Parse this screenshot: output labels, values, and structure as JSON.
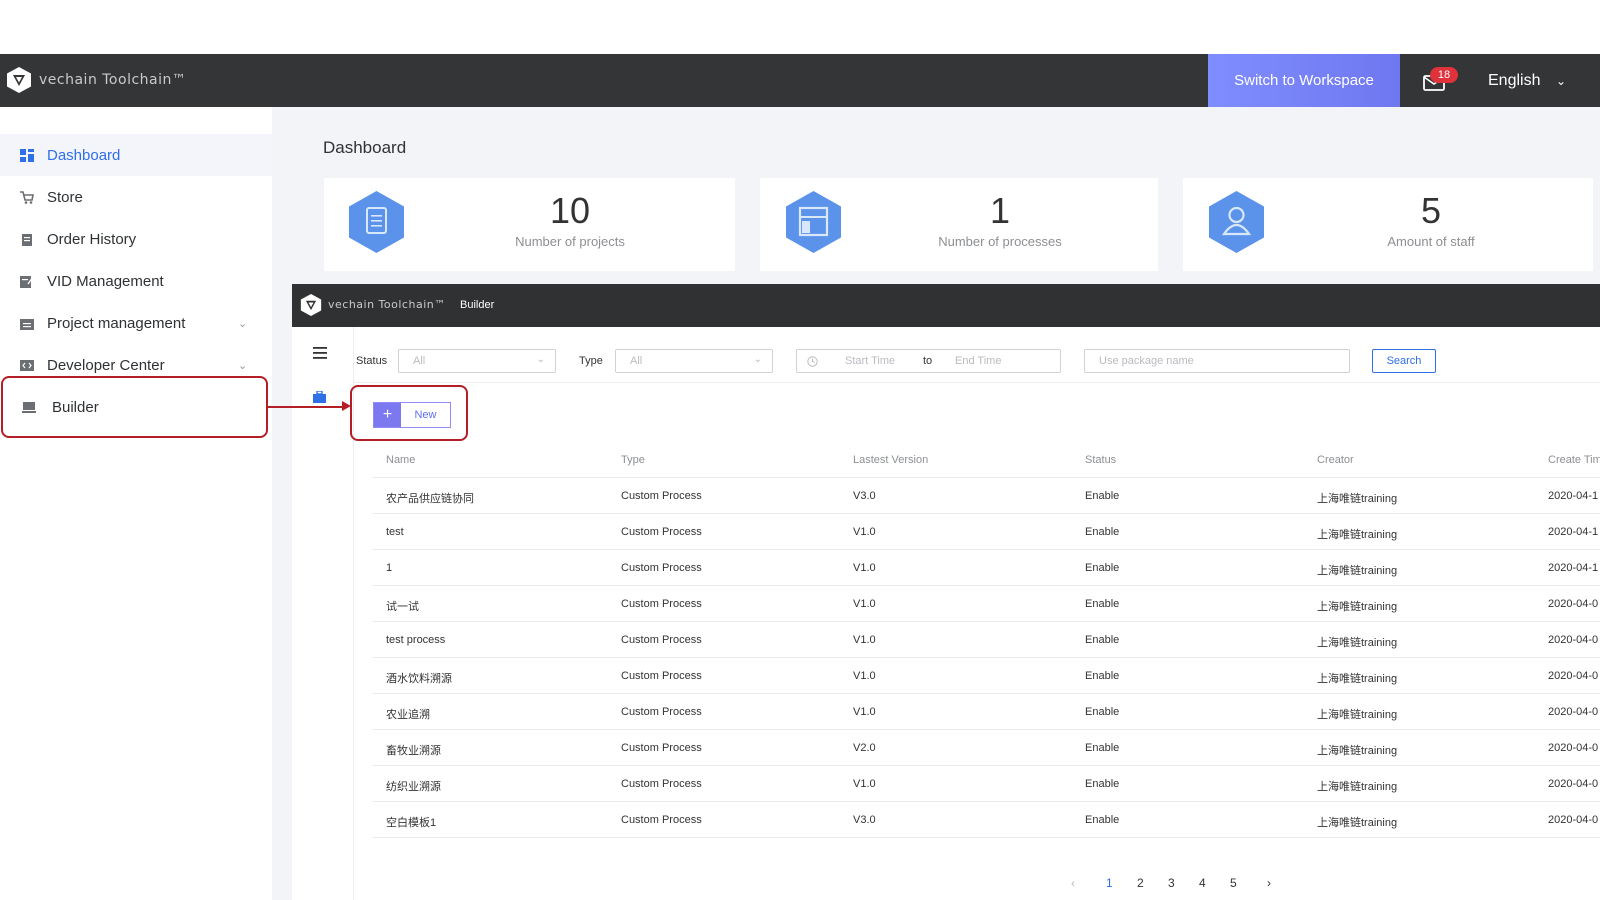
{
  "topbar": {
    "logo_text": "vechain Toolchain™",
    "switch_label": "Switch to Workspace",
    "mail_badge": "18",
    "language": "English"
  },
  "sidebar": {
    "items": [
      {
        "label": "Dashboard",
        "icon": "dashboard-icon"
      },
      {
        "label": "Store",
        "icon": "cart-icon"
      },
      {
        "label": "Order History",
        "icon": "clipboard-icon"
      },
      {
        "label": "VID Management",
        "icon": "edit-doc-icon"
      },
      {
        "label": "Project management",
        "icon": "folder-icon"
      },
      {
        "label": "Developer Center",
        "icon": "code-icon"
      },
      {
        "label": "Builder",
        "icon": "laptop-icon"
      }
    ]
  },
  "main": {
    "title": "Dashboard",
    "cards": [
      {
        "value": "10",
        "label": "Number of projects",
        "icon": "document-icon"
      },
      {
        "value": "1",
        "label": "Number of processes",
        "icon": "layout-icon"
      },
      {
        "value": "5",
        "label": "Amount of staff",
        "icon": "user-icon"
      }
    ]
  },
  "builder": {
    "logo_text": "vechain Toolchain™",
    "title": "Builder",
    "filters": {
      "status_label": "Status",
      "status_value": "All",
      "type_label": "Type",
      "type_value": "All",
      "start_placeholder": "Start Time",
      "to_label": "to",
      "end_placeholder": "End Time",
      "package_placeholder": "Use package name",
      "search_label": "Search"
    },
    "new_label": "New",
    "table": {
      "headers": [
        "Name",
        "Type",
        "Lastest Version",
        "Status",
        "Creator",
        "Create Tim"
      ],
      "rows": [
        [
          "农产品供应链协同",
          "Custom Process",
          "V3.0",
          "Enable",
          "上海唯链training",
          "2020-04-1"
        ],
        [
          "test",
          "Custom Process",
          "V1.0",
          "Enable",
          "上海唯链training",
          "2020-04-1"
        ],
        [
          "1",
          "Custom Process",
          "V1.0",
          "Enable",
          "上海唯链training",
          "2020-04-1"
        ],
        [
          "试一试",
          "Custom Process",
          "V1.0",
          "Enable",
          "上海唯链training",
          "2020-04-0"
        ],
        [
          "test process",
          "Custom Process",
          "V1.0",
          "Enable",
          "上海唯链training",
          "2020-04-0"
        ],
        [
          "酒水饮料溯源",
          "Custom Process",
          "V1.0",
          "Enable",
          "上海唯链training",
          "2020-04-0"
        ],
        [
          "农业追溯",
          "Custom Process",
          "V1.0",
          "Enable",
          "上海唯链training",
          "2020-04-0"
        ],
        [
          "畜牧业溯源",
          "Custom Process",
          "V2.0",
          "Enable",
          "上海唯链training",
          "2020-04-0"
        ],
        [
          "纺织业溯源",
          "Custom Process",
          "V1.0",
          "Enable",
          "上海唯链training",
          "2020-04-0"
        ],
        [
          "空白模板1",
          "Custom Process",
          "V3.0",
          "Enable",
          "上海唯链training",
          "2020-04-0"
        ]
      ]
    },
    "pagination": {
      "prev": "‹",
      "pages": [
        "1",
        "2",
        "3",
        "4",
        "5"
      ],
      "next": "›",
      "current": "1"
    }
  },
  "colors": {
    "accent": "#2f6fe8",
    "topbar": "#333537",
    "highlight": "#b41e26",
    "hexagon": "#5b93ea"
  }
}
